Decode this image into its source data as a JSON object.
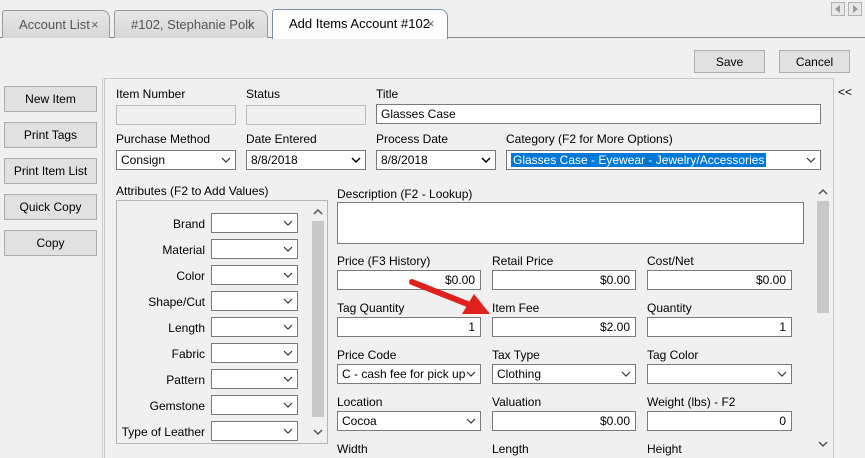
{
  "tabs": [
    {
      "label": "Account List"
    },
    {
      "label": "#102, Stephanie Polk"
    },
    {
      "label": "Add Items Account #102"
    }
  ],
  "tab_close_glyph": "×",
  "toolbar": {
    "save": "Save",
    "cancel": "Cancel",
    "collapse": "<<"
  },
  "left_buttons": [
    "New Item",
    "Print Tags",
    "Print Item List",
    "Quick Copy",
    "Copy"
  ],
  "form": {
    "item_number": {
      "label": "Item Number",
      "value": ""
    },
    "status": {
      "label": "Status",
      "value": ""
    },
    "title": {
      "label": "Title",
      "value": "Glasses Case"
    },
    "purchase_method": {
      "label": "Purchase Method",
      "value": "Consign"
    },
    "date_entered": {
      "label": "Date Entered",
      "value": "8/8/2018"
    },
    "process_date": {
      "label": "Process Date",
      "value": "8/8/2018"
    },
    "category": {
      "label": "Category (F2 for More Options)",
      "value": "Glasses Case - Eyewear - Jewelry/Accessories"
    },
    "attributes_label": "Attributes (F2 to Add Values)",
    "attributes": [
      "Brand",
      "Material",
      "Color",
      "Shape/Cut",
      "Length",
      "Fabric",
      "Pattern",
      "Gemstone",
      "Type of Leather"
    ],
    "description": {
      "label": "Description (F2 - Lookup)",
      "value": ""
    },
    "price": {
      "label": "Price (F3 History)",
      "value": "$0.00"
    },
    "retail_price": {
      "label": "Retail Price",
      "value": "$0.00"
    },
    "cost_net": {
      "label": "Cost/Net",
      "value": "$0.00"
    },
    "tag_quantity": {
      "label": "Tag Quantity",
      "value": "1"
    },
    "item_fee": {
      "label": "Item Fee",
      "value": "$2.00"
    },
    "quantity": {
      "label": "Quantity",
      "value": "1"
    },
    "price_code": {
      "label": "Price Code",
      "value": "C - cash fee for pick up"
    },
    "tax_type": {
      "label": "Tax Type",
      "value": "Clothing"
    },
    "tag_color": {
      "label": "Tag Color",
      "value": ""
    },
    "location": {
      "label": "Location",
      "value": "Cocoa"
    },
    "valuation": {
      "label": "Valuation",
      "value": "$0.00"
    },
    "weight": {
      "label": "Weight (lbs) - F2",
      "value": "0"
    },
    "width": {
      "label": "Width"
    },
    "length": {
      "label": "Length"
    },
    "height": {
      "label": "Height"
    }
  },
  "colors": {
    "selection": "#0078d7",
    "arrow": "#e0201c"
  }
}
